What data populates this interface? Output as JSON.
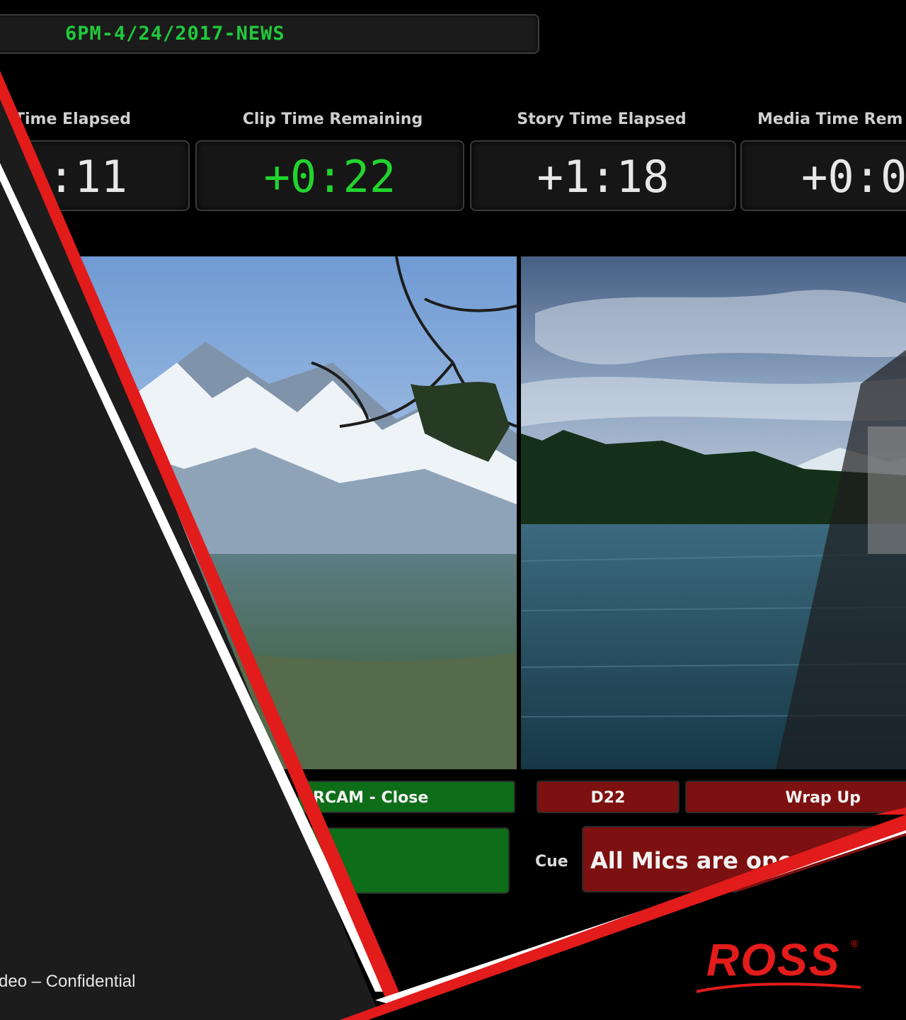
{
  "rundown": {
    "title": "6PM-4/24/2017-NEWS"
  },
  "timers": [
    {
      "label": "Time Elapsed",
      "value": ":11"
    },
    {
      "label": "Clip Time Remaining",
      "value": "+0:22"
    },
    {
      "label": "Story Time Elapsed",
      "value": "+1:18"
    },
    {
      "label": "Media Time Rem",
      "value": "+0:0"
    }
  ],
  "sources": {
    "left_source": "RCAM - Close",
    "right_source": "D22",
    "right_story": "Wrap Up"
  },
  "cue": {
    "label": "Cue",
    "text": "All Mics are ope"
  },
  "footer": {
    "text": "deo – Confidential"
  },
  "logo": {
    "text": "ROSS",
    "mark": "®"
  },
  "colors": {
    "accent_red": "#e21b1b",
    "tally_green": "#0e6d18",
    "tally_red": "#7d1010",
    "timer_green": "#22d42e",
    "slide_dark": "#1c1c1c"
  }
}
